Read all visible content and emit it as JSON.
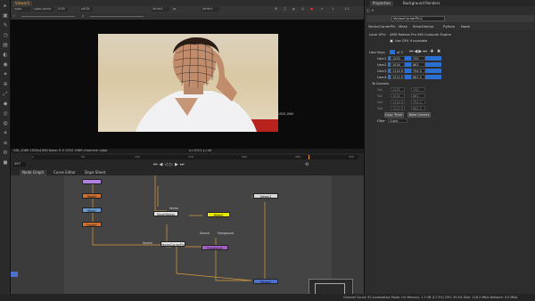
{
  "viewer": {
    "tab": "Viewer1",
    "channels": "rgba",
    "channels2": "rgba.alpha",
    "colorspace": "RGB",
    "proxy": "sRGB",
    "input_a": "Write2",
    "input_b": "Write1",
    "frame": "1",
    "zoom": "1:1",
    "format_info": "VID_1080 1920x1080 bbox: 0 0 1920 1080 channels: rgba",
    "coords": "x=1011 y=44",
    "timeline_ticks": [
      "1",
      "50",
      "100",
      "150",
      "200",
      "250",
      "300"
    ],
    "current_frame": "297"
  },
  "properties": {
    "tab1": "Properties",
    "tab2": "Background Renders",
    "node_name": "VectorCornerPin2",
    "subtabs": [
      "VectorCornerPin",
      "Mask",
      "SmartVector",
      "Python",
      "Node"
    ],
    "gpu_label": "Local GPU:",
    "gpu_value": "AMD Radeon Pro 560 Compute Engine",
    "use_gpu_label": "Use GPU if available",
    "user_keys_label": "User Keys",
    "key_count": "of 3",
    "to_rows": [
      {
        "label": "User1",
        "x": "1205",
        "y": "745"
      },
      {
        "label": "User2",
        "x": "1034",
        "y": "863"
      },
      {
        "label": "User3",
        "x": "1114.9",
        "y": "794.3"
      },
      {
        "label": "User4",
        "x": "1212.9",
        "y": "681.3"
      }
    ],
    "from_section": "To Corners",
    "from_rows": [
      {
        "label": "To1",
        "x": "1205",
        "y": "745"
      },
      {
        "label": "To2",
        "x": "1034",
        "y": "863"
      },
      {
        "label": "To3",
        "x": "1114.9",
        "y": "794.3"
      },
      {
        "label": "To4",
        "x": "1212.9",
        "y": "681.3"
      }
    ],
    "copy_from_btn": "Copy 'From'",
    "bake_btn": "Bake Corners",
    "filter_label": "Filter",
    "filter_value": "Cubic"
  },
  "graph": {
    "tabs": [
      "Node Graph",
      "Curve Editor",
      "Dope Sheet"
    ],
    "nodes": {
      "read_a": "Read2",
      "read_b": "Read1",
      "grade": "Grade1",
      "smartvector": "SmartVector",
      "write": "Write2",
      "viewer": "Viewer1",
      "vcp": "VectorCornerPin2",
      "transform": "Transform1",
      "source": "Source",
      "merge": "Merge1",
      "foreground": "Foreground",
      "vector_label": "Vector",
      "source_label": "Source"
    }
  },
  "status": "Channel Count: 92  Localization Mode: On  Memory: 1.7 GB (17.3%)  CPU: 29.4%  Disk: 116.2 MB/s  Network: 0.0 MB/s"
}
